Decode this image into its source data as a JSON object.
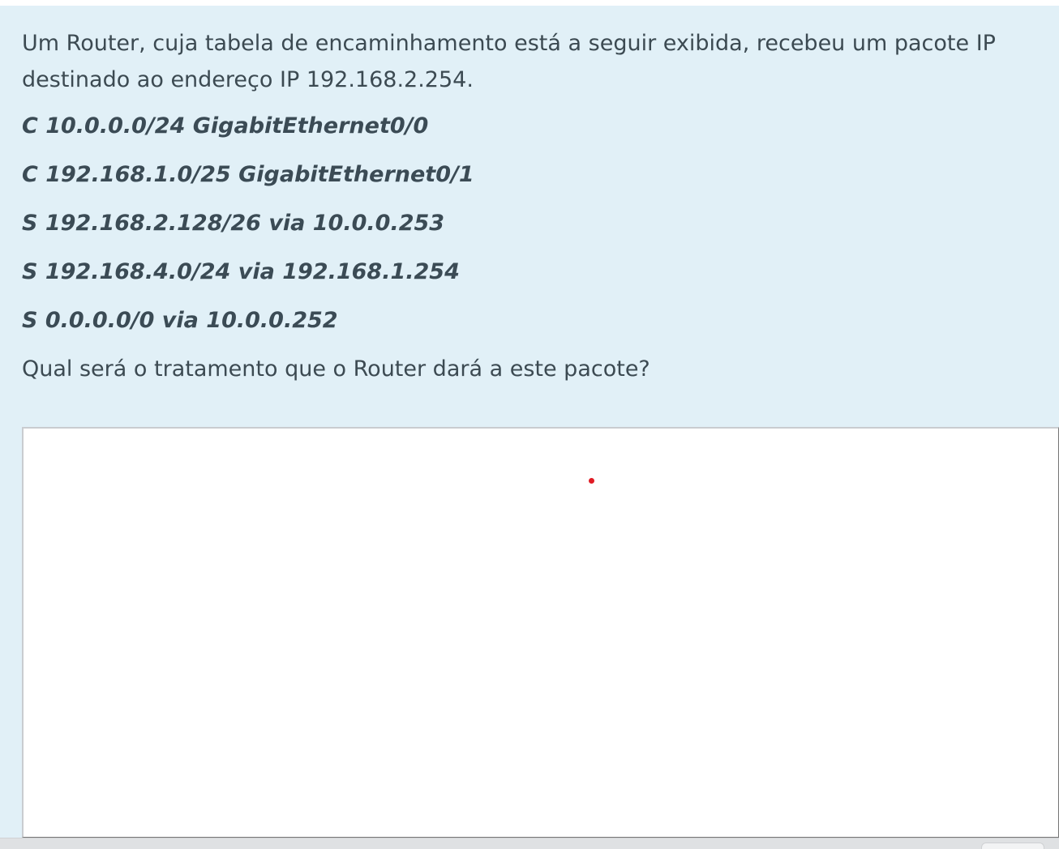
{
  "question": {
    "text": "Um Router, cuja tabela de encaminhamento está a seguir exibida, recebeu um pacote IP destinado ao endereço IP 192.168.2.254.",
    "routing_table": [
      "C 10.0.0.0/24 GigabitEthernet0/0",
      "C 192.168.1.0/25 GigabitEthernet0/1",
      "S 192.168.2.128/26 via 10.0.0.253",
      "S 192.168.4.0/24 via 192.168.1.254",
      "S 0.0.0.0/0 via 10.0.0.252"
    ],
    "prompt": "Qual será o tratamento que o Router dará a este pacote?"
  },
  "answer": {
    "value": ""
  },
  "colors": {
    "panel_background": "#e1f0f7",
    "text": "#3c4a52",
    "cursor_dot": "#e01b24"
  }
}
